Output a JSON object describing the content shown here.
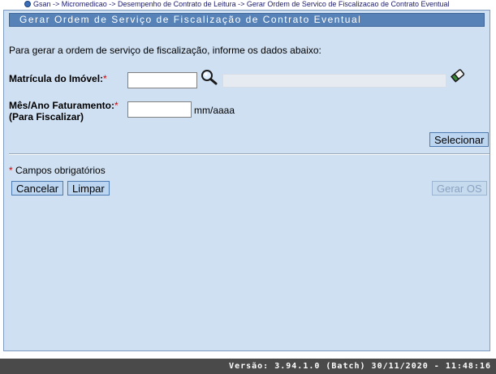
{
  "breadcrumb": {
    "icon": "home-icon",
    "text": "Gsan -> Micromedicao -> Desempenho de Contrato de Leitura -> Gerar Ordem de Servico de Fiscalizacao de Contrato Eventual"
  },
  "form": {
    "title": "Gerar Ordem de Serviço de Fiscalização de Contrato Eventual",
    "instructions": "Para gerar a ordem de serviço de fiscalização, informe os dados abaixo:",
    "matricula": {
      "label": "Matrícula do Imóvel:",
      "required_mark": "*",
      "value": "",
      "search_icon": "magnifier-search-icon",
      "description_value": "",
      "clear_icon": "eraser-clear-icon"
    },
    "mes_ano": {
      "label_line1": "Mês/Ano Faturamento:",
      "required_mark": "*",
      "label_line2": "(Para Fiscalizar)",
      "value": "",
      "unit_hint": "mm/aaaa"
    },
    "select_button": "Selecionar",
    "required_note_mark": "*",
    "required_note": "Campos obrigatórios",
    "cancel_button": "Cancelar",
    "clear_button": "Limpar",
    "generate_button": "Gerar OS"
  },
  "footer": {
    "version": "Versão: 3.94.1.0 (Batch) 30/11/2020 - 11:48:16"
  },
  "colors": {
    "panel_bg": "#cfe0f3",
    "title_bar": "#5682b8",
    "button_bg": "#bcd6f2",
    "required": "#d00000",
    "footer_bg": "#4a4a4a"
  }
}
